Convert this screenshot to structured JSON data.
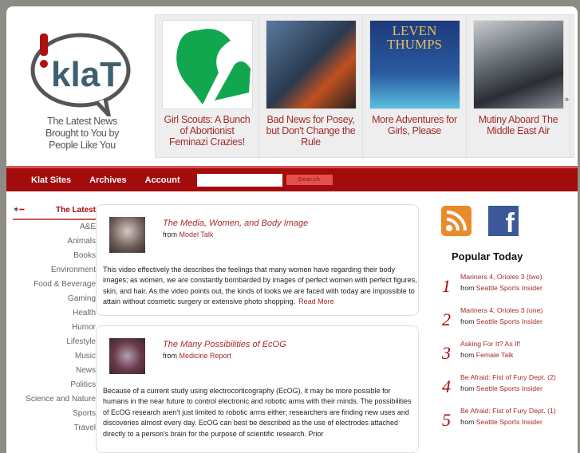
{
  "brand": {
    "logo_text": "!klaT",
    "tagline": "The Latest News Brought to You by People Like You"
  },
  "featured": [
    {
      "caption": "Girl Scouts: A Bunch of Abortionist Feminazi Crazies!",
      "image": "girl-scouts-logo"
    },
    {
      "caption": "Bad News for Posey, but Don't Change the Rule",
      "image": "baseball-player"
    },
    {
      "caption": "More Adventures for Girls, Please",
      "image": "leven-thumps-book-cover"
    },
    {
      "caption": "Mutiny Aboard The Middle East Air",
      "image": "airplane-cabin"
    }
  ],
  "featured_next": "»",
  "nav": {
    "items": [
      "Klat Sites",
      "Archives",
      "Account"
    ],
    "search_placeholder": "",
    "search_label": "Search"
  },
  "sidebar": {
    "active": "The Latest",
    "items": [
      "A&E",
      "Animals",
      "Books",
      "Environment",
      "Food & Beverage",
      "Gaming",
      "Health",
      "Humor",
      "Lifestyle",
      "Music",
      "News",
      "Politics",
      "Science and Nature",
      "Sports",
      "Travel"
    ]
  },
  "articles": [
    {
      "title": "The Media, Women, and Body Image",
      "from": "from",
      "source": "Model Talk",
      "body": "This video effectively the describes the feelings that many women have regarding their body images; as women, we are constantly bombarded by images of perfect women with perfect figures, skin, and hair. As the video points out, the kinds of looks we are faced with today are impossible to attain without cosmetic surgery or extensive photo shopping.",
      "read_more": "Read More"
    },
    {
      "title": "The Many Possibilities of EcOG",
      "from": "from",
      "source": "Medicine Report",
      "body": "Because of a current study using electrocorticography (EcOG), it may be more possible for humans in the near future to control electronic and robotic arms with their minds. The possibilities of  EcOG research aren't just limited to robotic arms either; researchers are finding new uses and discoveries almost every day.   EcOG can best be described as the use of electrodes attached directly to a person's brain for the purpose of scientific research. Prior"
    }
  ],
  "popular": {
    "title": "Popular Today",
    "items": [
      {
        "num": "1",
        "title": "Mariners 4, Orioles 3 (two)",
        "from": "from",
        "source": "Seattle Sports Insider"
      },
      {
        "num": "2",
        "title": "Mariners 4, Orioles 3 (one)",
        "from": "from",
        "source": "Seattle Sports Insider"
      },
      {
        "num": "3",
        "title": "Asking For It? As If!",
        "from": "from",
        "source": "Female Talk"
      },
      {
        "num": "4",
        "title": "Be Afraid: Fist of Fury Dept. (2)",
        "from": "from",
        "source": "Seattle Sports Insider"
      },
      {
        "num": "5",
        "title": "Be Afraid: Fist of Fury Dept. (1)",
        "from": "from",
        "source": "Seattle Sports Insider"
      }
    ]
  },
  "social": {
    "rss": "rss-icon",
    "facebook": "f"
  },
  "colors": {
    "accent": "#a30c0c",
    "link": "#a52a2a"
  }
}
